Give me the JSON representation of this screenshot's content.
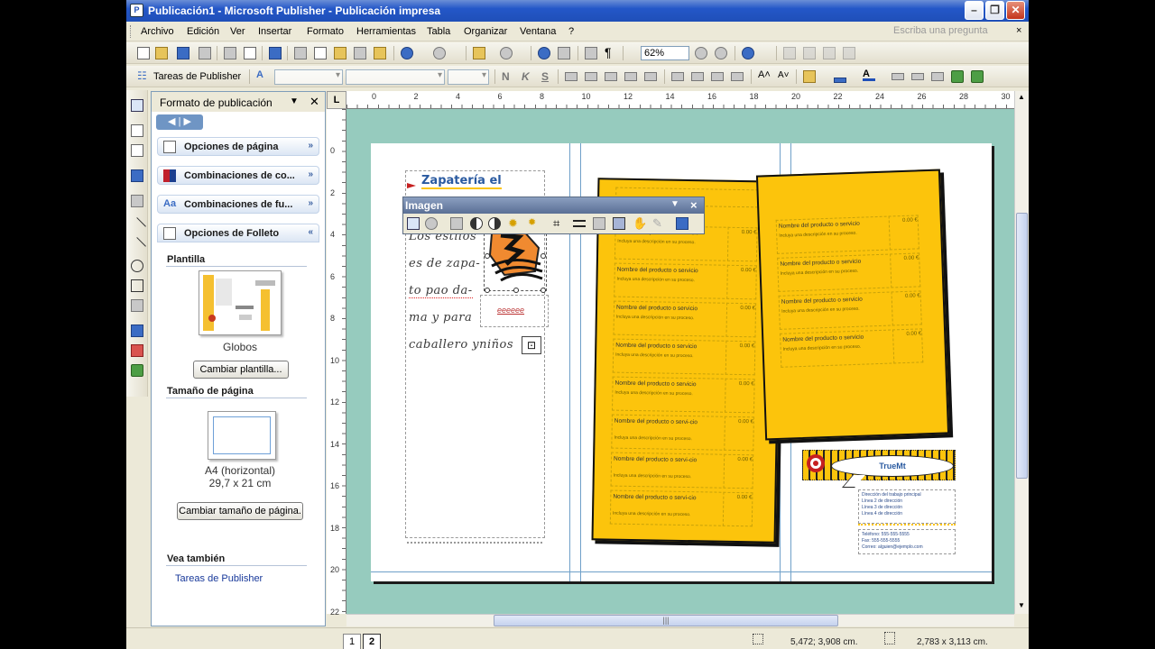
{
  "window": {
    "title": "Publicación1 - Microsoft Publisher - Publicación impresa",
    "app_icon": "publisher-icon"
  },
  "menu": {
    "items": [
      "Archivo",
      "Edición",
      "Ver",
      "Insertar",
      "Formato",
      "Herramientas",
      "Tabla",
      "Organizar",
      "Ventana",
      "?"
    ],
    "ask_placeholder": "Escriba una pregunta",
    "ask_close": "×"
  },
  "toolbar": {
    "zoom": "62%",
    "tasks_label": "Tareas de Publisher",
    "bold": "N",
    "italic": "K",
    "underline": "S"
  },
  "task_pane": {
    "title": "Formato de publicación",
    "sections": [
      {
        "label": "Opciones de página",
        "icon": "page-icon"
      },
      {
        "label": "Combinaciones de co...",
        "icon": "color-scheme-icon"
      },
      {
        "label": "Combinaciones de fu...",
        "icon": "font-scheme-icon"
      },
      {
        "label": "Opciones de Folleto",
        "icon": "brochure-icon"
      }
    ],
    "template_heading": "Plantilla",
    "template_name": "Globos",
    "change_template_button": "Cambiar plantilla...",
    "page_size_heading": "Tamaño de página",
    "page_size_name": "A4 (horizontal)",
    "page_size_dims": "29,7 x 21 cm",
    "change_size_button": "Cambiar tamaño de página.",
    "see_also_heading": "Vea también",
    "see_also_link": "Tareas de Publisher"
  },
  "ruler": {
    "corner": "L",
    "h_labels": [
      "0",
      "2",
      "4",
      "6",
      "8",
      "10",
      "12",
      "14",
      "16",
      "18",
      "20",
      "22",
      "24",
      "26",
      "28",
      "30"
    ],
    "v_labels": [
      "0",
      "2",
      "4",
      "6",
      "8",
      "10",
      "12",
      "14",
      "16",
      "18",
      "20",
      "22"
    ]
  },
  "image_toolbar": {
    "title": "Imagen",
    "close": "×"
  },
  "document": {
    "heading": "Zapatería el",
    "body_lines": [
      "Los estilos",
      "es de zapa-",
      "to pao da-",
      "ma y para",
      "caballero yniños"
    ],
    "logo_caption": "eeeeee",
    "product_name": "Nombre del producto o servicio",
    "product_name_wrapped": "Nombre del producto o servi-cio",
    "product_desc": "Incluya una descripción en su proceso.",
    "price": "0.00 €",
    "banner_text": "TrueMt",
    "address_lines": [
      "Dirección del trabajo principal",
      "Línea 2 de dirección",
      "Línea 3 de dirección",
      "Línea 4 de dirección"
    ],
    "phone_lines": [
      "Teléfono: 555-555-5555",
      "Fax: 555-555-5555",
      "Correo: alguien@ejemplo.com"
    ]
  },
  "status": {
    "pages": [
      "1",
      "2"
    ],
    "active_page": "2",
    "position": "5,472; 3,908 cm.",
    "size": "2,783 x  3,113 cm."
  },
  "colors": {
    "canvas": "#96cbbe",
    "panel": "#fcc40c",
    "title_bar": "#2457c8"
  }
}
